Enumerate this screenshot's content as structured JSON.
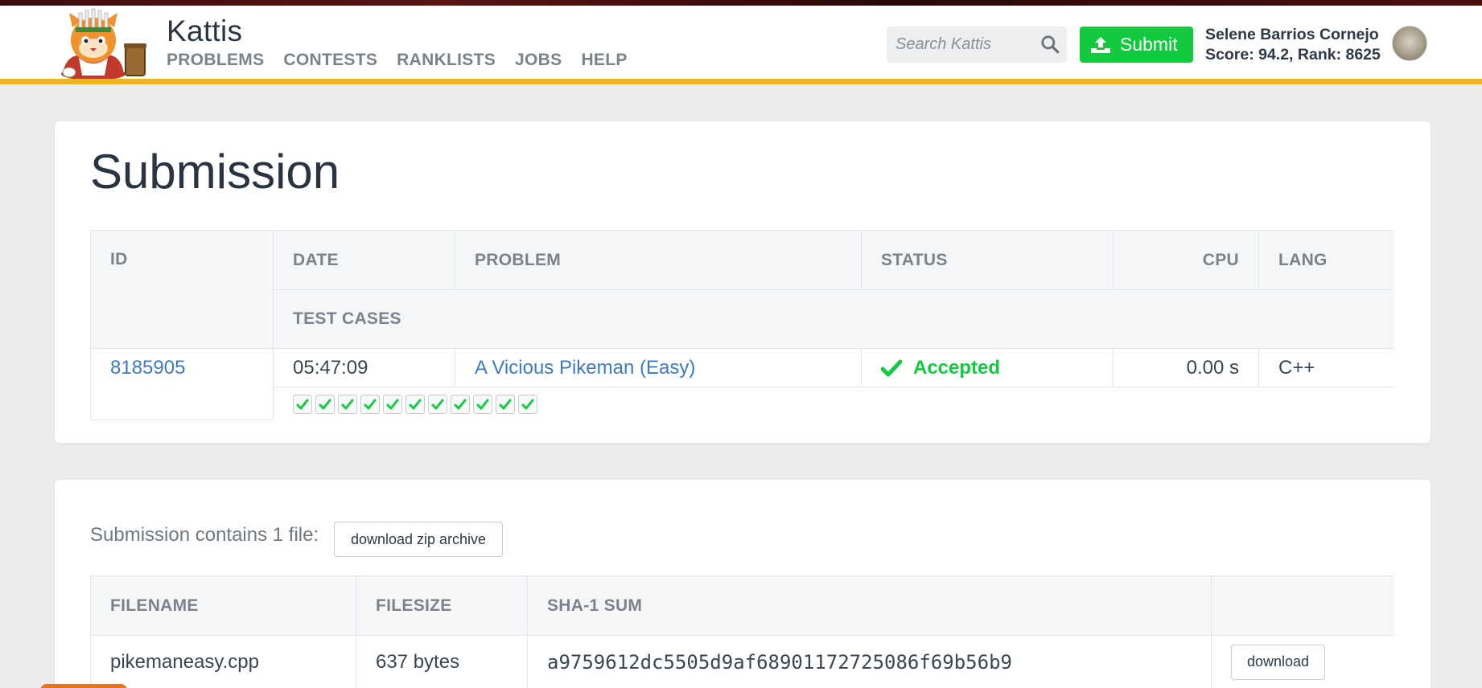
{
  "header": {
    "brand": "Kattis",
    "nav": [
      "PROBLEMS",
      "CONTESTS",
      "RANKLISTS",
      "JOBS",
      "HELP"
    ],
    "search_placeholder": "Search Kattis",
    "submit_label": "Submit",
    "user_name": "Selene Barrios Cornejo",
    "user_stats": "Score: 94.2, Rank: 8625"
  },
  "page": {
    "title": "Submission"
  },
  "submission_table": {
    "headers": {
      "id": "ID",
      "date": "DATE",
      "problem": "PROBLEM",
      "status": "STATUS",
      "cpu": "CPU",
      "lang": "LANG",
      "test_cases": "TEST CASES"
    },
    "row": {
      "id": "8185905",
      "date": "05:47:09",
      "problem": "A Vicious Pikeman (Easy)",
      "status": "Accepted",
      "cpu": "0.00 s",
      "lang": "C++",
      "test_cases_passed": 11,
      "test_cases_total": 11
    }
  },
  "files": {
    "label": "Submission contains 1 file:",
    "download_zip_label": "download zip archive",
    "headers": {
      "filename": "FILENAME",
      "filesize": "FILESIZE",
      "sha1": "SHA-1 SUM"
    },
    "rows": [
      {
        "filename": "pikemaneasy.cpp",
        "filesize": "637 bytes",
        "sha1": "a9759612dc5505d9af68901172725086f69b56b9",
        "download_label": "download"
      }
    ]
  },
  "colors": {
    "accent_bar": "#f2b31b",
    "success": "#12c940",
    "link": "#3d7bbf"
  }
}
